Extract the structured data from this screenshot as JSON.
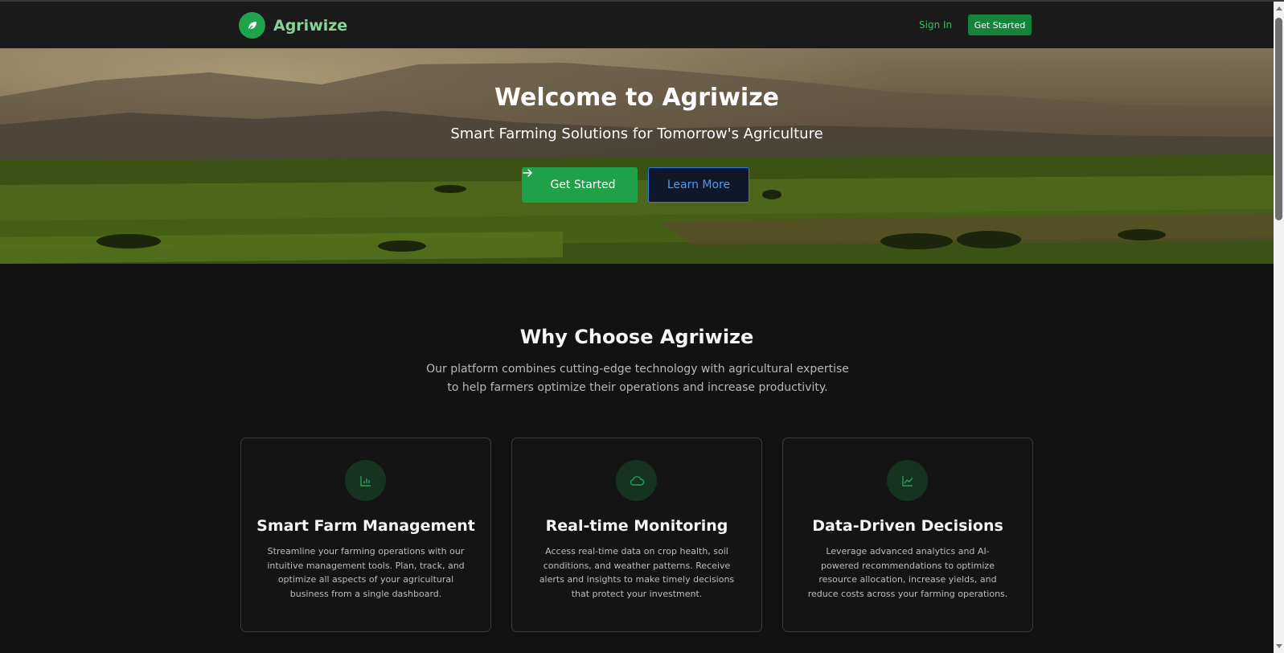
{
  "nav": {
    "brand": "Agriwize",
    "sign_in": "Sign In",
    "cta": "Get Started",
    "logo_icon": "leaf-icon"
  },
  "hero": {
    "title": "Welcome to Agriwize",
    "subtitle": "Smart Farming Solutions for Tomorrow's Agriculture",
    "primary_button": "Get Started",
    "primary_icon": "arrow-right-icon",
    "secondary_button": "Learn More"
  },
  "features": {
    "title": "Why Choose Agriwize",
    "description": "Our platform combines cutting-edge technology with agricultural expertise to help farmers optimize their operations and increase productivity.",
    "cards": [
      {
        "icon": "bar-chart-icon",
        "title": "Smart Farm Management",
        "text": "Streamline your farming operations with our intuitive management tools. Plan, track, and optimize all aspects of your agricultural business from a single dashboard."
      },
      {
        "icon": "cloud-icon",
        "title": "Real-time Monitoring",
        "text": "Access real-time data on crop health, soil conditions, and weather patterns. Receive alerts and insights to make timely decisions that protect your investment."
      },
      {
        "icon": "line-chart-icon",
        "title": "Data-Driven Decisions",
        "text": "Leverage advanced analytics and AI-powered recommendations to optimize resource allocation, increase yields, and reduce costs across your farming operations."
      }
    ]
  },
  "colors": {
    "accent": "#1fa148",
    "brand_text": "#86d69b",
    "background": "#121212",
    "secondary_border": "#2f7de0"
  }
}
